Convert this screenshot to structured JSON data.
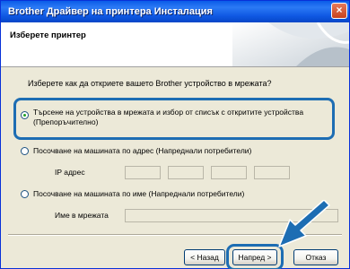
{
  "window": {
    "title": "Brother Драйвер на принтера Инсталация",
    "close_symbol": "×"
  },
  "header": {
    "title": "Изберете принтер"
  },
  "question": "Изберете как да откриете вашето Brother устройство в мрежата?",
  "options": [
    {
      "label": "Търсене на устройства в мрежата и избор от списък с откритите устройства (Препоръчително)",
      "checked": true
    },
    {
      "label": "Посочване на машината по адрес (Напреднали потребители)",
      "checked": false
    },
    {
      "label": "Посочване на машината по име (Напреднали потребители)",
      "checked": false
    }
  ],
  "fields": {
    "ip_label": "IP адрес",
    "name_label": "Име в мрежата"
  },
  "buttons": {
    "back_label": "< Назад",
    "next_label": "Напред >",
    "cancel_label": "Отказ"
  },
  "colors": {
    "highlight": "#1d6db3",
    "titlebar": "#0a5be8",
    "dialog_bg": "#ece9d8"
  },
  "icons": {
    "pointer": "arrow-pointer-icon",
    "close": "close-icon"
  }
}
